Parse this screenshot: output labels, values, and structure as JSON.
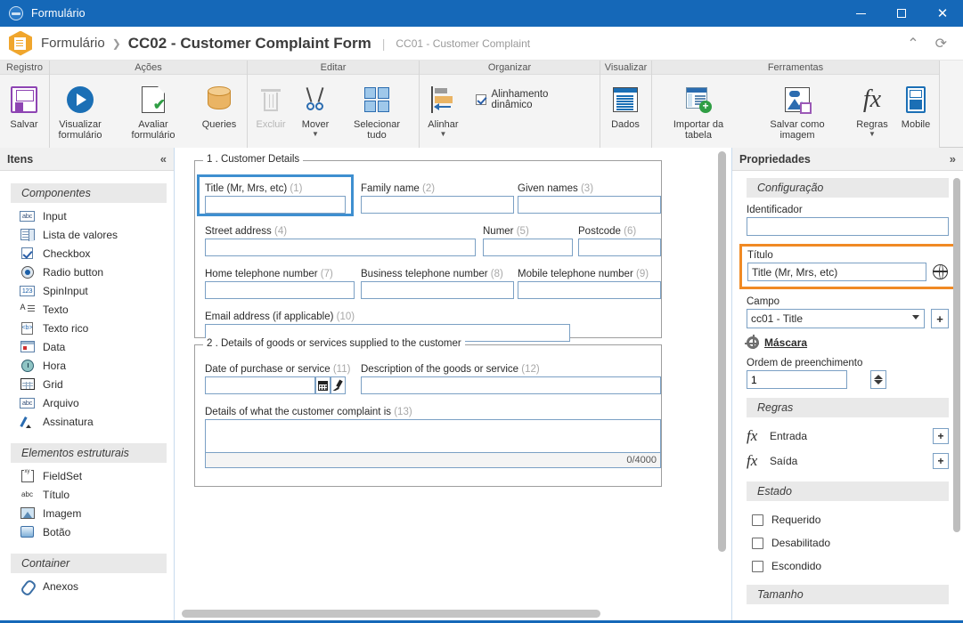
{
  "window": {
    "title": "Formulário",
    "icon": "app-globe-icon",
    "minimize": "–",
    "maximize": "□",
    "close": "✕",
    "accent": "#1568b8"
  },
  "header": {
    "icon": "form-hex-icon",
    "breadcrumb_root": "Formulário",
    "breadcrumb_sep": "❯",
    "page_title": "CC02 - Customer Complaint Form",
    "pipe": "|",
    "subtitle": "CC01 - Customer Complaint",
    "collapse_icon": "chevron-up-icon",
    "refresh_icon": "refresh-icon"
  },
  "ribbon": {
    "groups": [
      {
        "name": "Registro",
        "buttons": [
          {
            "label": "Salvar",
            "icon": "save-icon",
            "disabled": false,
            "caret": false
          }
        ]
      },
      {
        "name": "Ações",
        "buttons": [
          {
            "label": "Visualizar formulário",
            "icon": "play-icon",
            "disabled": false,
            "caret": false
          },
          {
            "label": "Avaliar formulário",
            "icon": "document-check-icon",
            "disabled": false,
            "caret": false
          },
          {
            "label": "Queries",
            "icon": "database-icon",
            "disabled": false,
            "caret": false
          }
        ]
      },
      {
        "name": "Editar",
        "buttons": [
          {
            "label": "Excluir",
            "icon": "trash-icon",
            "disabled": true,
            "caret": false
          },
          {
            "label": "Mover",
            "icon": "scissors-icon",
            "disabled": false,
            "caret": true
          },
          {
            "label": "Selecionar tudo",
            "icon": "select-all-icon",
            "disabled": false,
            "caret": false
          }
        ]
      },
      {
        "name": "Organizar",
        "buttons": [
          {
            "label": "Alinhar",
            "icon": "align-icon",
            "disabled": false,
            "caret": true
          }
        ],
        "checkbox": {
          "label": "Alinhamento dinâmico",
          "checked": true
        }
      },
      {
        "name": "Visualizar",
        "buttons": [
          {
            "label": "Dados",
            "icon": "data-icon",
            "disabled": false,
            "caret": false
          }
        ]
      },
      {
        "name": "Ferramentas",
        "buttons": [
          {
            "label": "Importar da tabela",
            "icon": "import-table-icon",
            "disabled": false,
            "caret": false
          },
          {
            "label": "Salvar como imagem",
            "icon": "save-image-icon",
            "disabled": false,
            "caret": false
          },
          {
            "label": "Regras",
            "icon": "fx-icon",
            "disabled": false,
            "caret": true
          },
          {
            "label": "Mobile",
            "icon": "mobile-icon",
            "disabled": false,
            "caret": false
          }
        ]
      }
    ]
  },
  "left_panel": {
    "title": "Itens",
    "collapse_icon": "chevron-double-left-icon",
    "sections": [
      {
        "title": "Componentes",
        "items": [
          {
            "label": "Input",
            "icon": "abc-box-icon"
          },
          {
            "label": "Lista de valores",
            "icon": "list-box-icon"
          },
          {
            "label": "Checkbox",
            "icon": "checkbox-icon"
          },
          {
            "label": "Radio button",
            "icon": "radio-icon"
          },
          {
            "label": "SpinInput",
            "icon": "123-box-icon"
          },
          {
            "label": "Texto",
            "icon": "text-icon"
          },
          {
            "label": "Texto rico",
            "icon": "rich-text-icon"
          },
          {
            "label": "Data",
            "icon": "calendar-icon"
          },
          {
            "label": "Hora",
            "icon": "clock-icon"
          },
          {
            "label": "Grid",
            "icon": "grid-icon"
          },
          {
            "label": "Arquivo",
            "icon": "abc-box-icon"
          },
          {
            "label": "Assinatura",
            "icon": "pen-icon"
          }
        ]
      },
      {
        "title": "Elementos estruturais",
        "items": [
          {
            "label": "FieldSet",
            "icon": "fieldset-icon"
          },
          {
            "label": "Título",
            "icon": "abc-text-icon"
          },
          {
            "label": "Imagem",
            "icon": "image-icon"
          },
          {
            "label": "Botão",
            "icon": "button-icon"
          }
        ]
      },
      {
        "title": "Container",
        "items": [
          {
            "label": "Anexos",
            "icon": "paperclip-icon"
          }
        ]
      }
    ]
  },
  "canvas": {
    "fieldsets": [
      {
        "legend": "1 . Customer Details",
        "fields": [
          {
            "label": "Title (Mr, Mrs, etc)",
            "num": "(1)",
            "selected": true
          },
          {
            "label": "Family name",
            "num": "(2)",
            "selected": false
          },
          {
            "label": "Given names",
            "num": "(3)",
            "selected": false
          },
          {
            "label": "Street address",
            "num": "(4)",
            "selected": false
          },
          {
            "label": "Numer",
            "num": "(5)",
            "selected": false
          },
          {
            "label": "Postcode",
            "num": "(6)",
            "selected": false
          },
          {
            "label": "Home telephone number",
            "num": "(7)",
            "selected": false
          },
          {
            "label": "Business telephone number",
            "num": "(8)",
            "selected": false
          },
          {
            "label": "Mobile telephone number",
            "num": "(9)",
            "selected": false
          },
          {
            "label": "Email address (if applicable)",
            "num": "(10)",
            "selected": false
          }
        ]
      },
      {
        "legend": "2 . Details of goods or services supplied to the customer",
        "fields": [
          {
            "label": "Date of purchase or service",
            "num": "(11)",
            "selected": false
          },
          {
            "label": "Description of the goods or service",
            "num": "(12)",
            "selected": false
          },
          {
            "label": "Details of what the customer complaint is",
            "num": "(13)",
            "selected": false
          }
        ],
        "counter": "0/4000"
      }
    ]
  },
  "right_panel": {
    "title": "Propriedades",
    "expand_icon": "chevron-double-right-icon",
    "sections": {
      "configuracao": {
        "title": "Configuração",
        "identificador_label": "Identificador",
        "identificador_value": "",
        "titulo_label": "Título",
        "titulo_value": "Title (Mr, Mrs, etc)",
        "titulo_globe_icon": "globe-icon",
        "campo_label": "Campo",
        "campo_value": "cc01 - Title",
        "campo_add": "+",
        "mascara_label": "Máscara",
        "mascara_icon": "gear-icon",
        "ordem_label": "Ordem de preenchimento",
        "ordem_value": "1"
      },
      "regras": {
        "title": "Regras",
        "rows": [
          {
            "label": "Entrada",
            "icon": "fx-icon",
            "add": "+"
          },
          {
            "label": "Saída",
            "icon": "fx-icon",
            "add": "+"
          }
        ]
      },
      "estado": {
        "title": "Estado",
        "options": [
          {
            "label": "Requerido",
            "checked": false
          },
          {
            "label": "Desabilitado",
            "checked": false
          },
          {
            "label": "Escondido",
            "checked": false
          }
        ]
      },
      "tamanho": {
        "title": "Tamanho"
      }
    },
    "highlight_color": "#f08a24"
  }
}
